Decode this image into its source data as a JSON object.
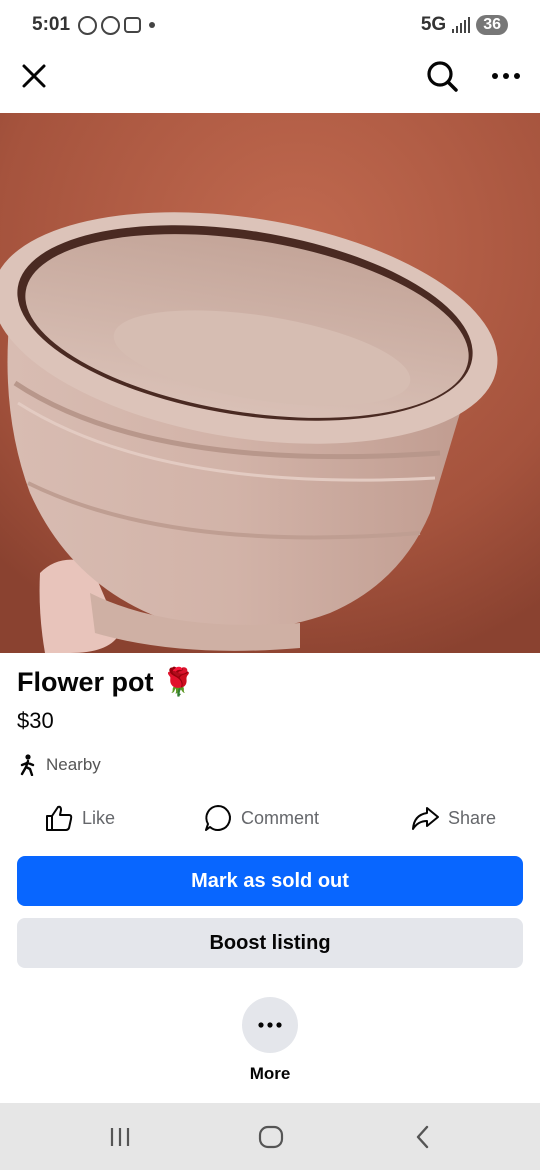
{
  "status_bar": {
    "time": "5:01",
    "network": "5G",
    "battery": "36",
    "notification_icons": [
      "system-icon",
      "messenger-icon",
      "screenshot-icon"
    ]
  },
  "header": {
    "close_icon": "close-icon",
    "search_icon": "search-icon",
    "more_icon": "more-options-icon"
  },
  "listing": {
    "photo_description_icon": "flower-pot-photo",
    "title": "Flower pot",
    "title_emoji": "🌹",
    "price": "$30",
    "location": "Nearby"
  },
  "actions": {
    "like_label": "Like",
    "comment_label": "Comment",
    "share_label": "Share"
  },
  "buttons": {
    "mark_sold": "Mark as sold out",
    "boost": "Boost listing",
    "more": "More"
  },
  "colors": {
    "primary": "#0866ff",
    "secondary_bg": "#e4e6eb",
    "muted_text": "#65676b"
  }
}
